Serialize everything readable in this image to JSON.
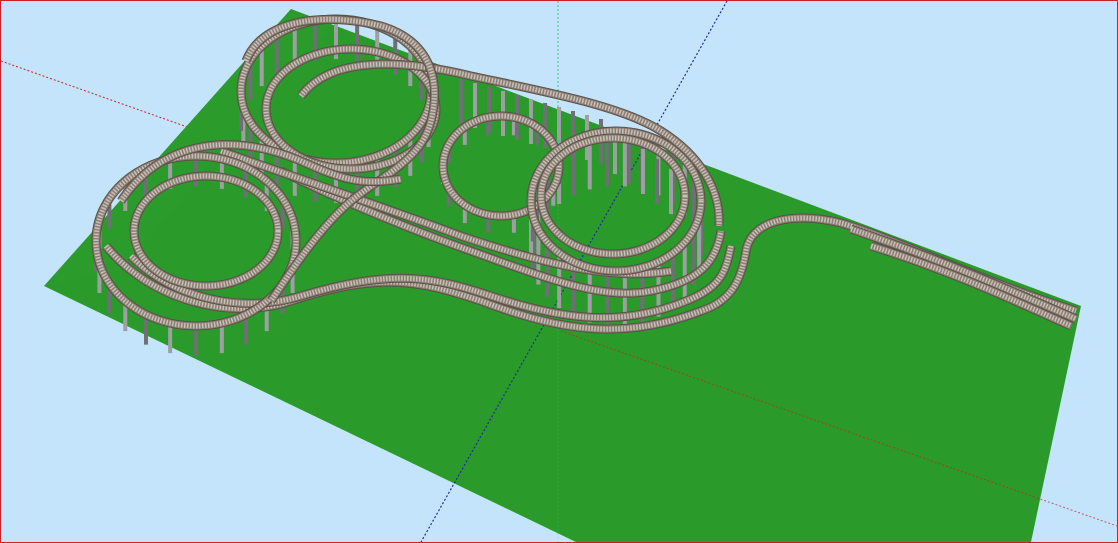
{
  "viewport": {
    "view": "3d-perspective",
    "colors": {
      "sky": "#c4e4fb",
      "ground": "#2a9a2a",
      "ground_shade": "#217a21",
      "track_bed": "#8b7d72",
      "track_edge": "#5a5048",
      "rail": "#c9c2bb",
      "pier": "#9d9fa3",
      "pier_shade": "#6e7075",
      "axis_red": "#cc2222",
      "axis_green": "#33cc77",
      "axis_blue": "#1a2f9a",
      "frame": "#c8202a"
    },
    "icons": [
      "axis-origin-icon"
    ],
    "status_text": ""
  }
}
